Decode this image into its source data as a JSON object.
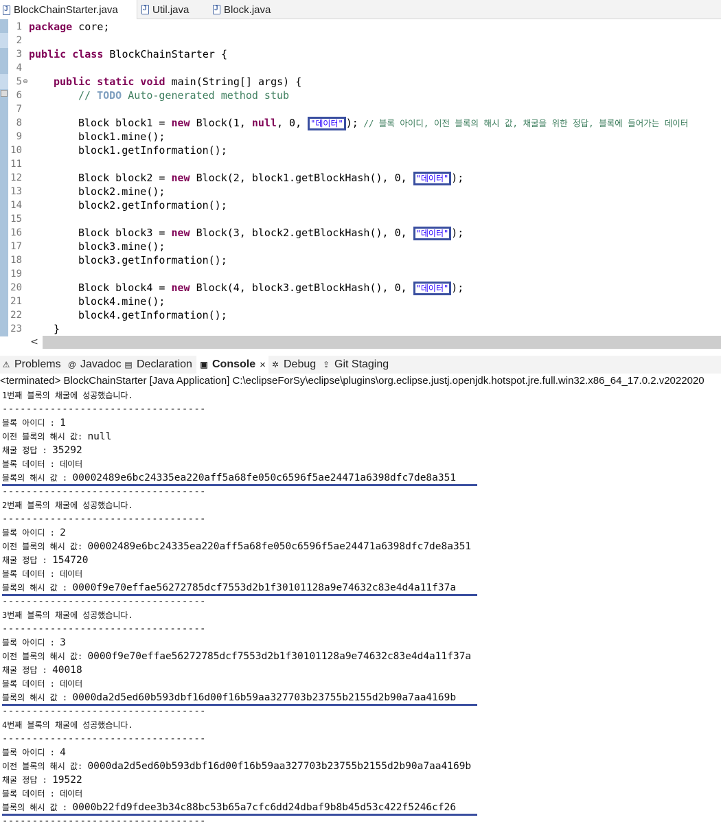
{
  "editor_tabs": [
    {
      "label": "BlockChainStarter.java",
      "active": true
    },
    {
      "label": "Util.java",
      "active": false
    },
    {
      "label": "Block.java",
      "active": false
    }
  ],
  "code": {
    "line_numbers": [
      "1",
      "2",
      "3",
      "4",
      "5",
      "6",
      "7",
      "8",
      "9",
      "10",
      "11",
      "12",
      "13",
      "14",
      "15",
      "16",
      "17",
      "18",
      "19",
      "20",
      "21",
      "22",
      "23"
    ],
    "package_kw": "package",
    "package_name": " core;",
    "class_mods": "public class",
    "class_name": " BlockChainStarter {",
    "main_mods": "public static void",
    "main_sig": " main(String[] args) {",
    "todo_comment_prefix": "// ",
    "todo_kw": "TODO",
    "todo_rest": " Auto-generated method stub",
    "new_kw": "new",
    "null_kw": "null",
    "data_string": "\"데이터\"",
    "block1_decl": "Block block1 = ",
    "block1_args_a": " Block(1, ",
    "block1_args_b": ", 0, ",
    "block1_close": ");",
    "block1_comment": " // 블록 아이디, 이전 블록의 해시 값, 채굴을 위한 정답, 블록에 들어가는 데이터",
    "block1_mine": "block1.mine();",
    "block1_info": "block1.getInformation();",
    "block2_decl": "Block block2 = ",
    "block2_args": " Block(2, block1.getBlockHash(), 0, ",
    "block2_close": ");",
    "block2_mine": "block2.mine();",
    "block2_info": "block2.getInformation();",
    "block3_decl": "Block block3 = ",
    "block3_args": " Block(3, block2.getBlockHash(), 0, ",
    "block3_close": ");",
    "block3_mine": "block3.mine();",
    "block3_info": "block3.getInformation();",
    "block4_decl": "Block block4 = ",
    "block4_args": " Block(4, block3.getBlockHash(), 0, ",
    "block4_close": ");",
    "block4_mine": "block4.mine();",
    "block4_info": "block4.getInformation();",
    "closing_brace": "}"
  },
  "view_tabs": [
    {
      "label": "Problems",
      "icon": "problems-icon"
    },
    {
      "label": "Javadoc",
      "icon": "at-icon"
    },
    {
      "label": "Declaration",
      "icon": "declaration-icon"
    },
    {
      "label": "Console",
      "icon": "console-icon",
      "active": true
    },
    {
      "label": "Debug",
      "icon": "bug-icon"
    },
    {
      "label": "Git Staging",
      "icon": "git-staging-icon"
    }
  ],
  "console": {
    "header": "<terminated> BlockChainStarter [Java Application] C:\\eclipseForSy\\eclipse\\plugins\\org.eclipse.justj.openjdk.hotspot.jre.full.win32.x86_64_17.0.2.v2022020",
    "separator": "----------------------------------",
    "blocks": [
      {
        "success": "1번째 블록의 채굴에 성공했습니다.",
        "id_label": "블록 아이디 : ",
        "id": "1",
        "prev_label": "이전 블록의 해시 값: ",
        "prev": "null",
        "answer_label": "채굴 정답 : ",
        "answer": "35292",
        "data_label": "블록 데이터 : 데이터",
        "hash_label": "블록의 해시 값 : ",
        "hash": "00002489e6bc24335ea220aff5a68fe050c6596f5ae24471a6398dfc7de8a351"
      },
      {
        "success": "2번째 블록의 채굴에 성공했습니다.",
        "id_label": "블록 아이디 : ",
        "id": "2",
        "prev_label": "이전 블록의 해시 값: ",
        "prev": "00002489e6bc24335ea220aff5a68fe050c6596f5ae24471a6398dfc7de8a351",
        "answer_label": "채굴 정답 : ",
        "answer": "154720",
        "data_label": "블록 데이터 : 데이터",
        "hash_label": "블록의 해시 값 : ",
        "hash": "0000f9e70effae56272785dcf7553d2b1f30101128a9e74632c83e4d4a11f37a"
      },
      {
        "success": "3번째 블록의 채굴에 성공했습니다.",
        "id_label": "블록 아이디 : ",
        "id": "3",
        "prev_label": "이전 블록의 해시 값: ",
        "prev": "0000f9e70effae56272785dcf7553d2b1f30101128a9e74632c83e4d4a11f37a",
        "answer_label": "채굴 정답 : ",
        "answer": "40018",
        "data_label": "블록 데이터 : 데이터",
        "hash_label": "블록의 해시 값 : ",
        "hash": "0000da2d5ed60b593dbf16d00f16b59aa327703b23755b2155d2b90a7aa4169b"
      },
      {
        "success": "4번째 블록의 채굴에 성공했습니다.",
        "id_label": "블록 아이디 : ",
        "id": "4",
        "prev_label": "이전 블록의 해시 값: ",
        "prev": "0000da2d5ed60b593dbf16d00f16b59aa327703b23755b2155d2b90a7aa4169b",
        "answer_label": "채굴 정답 : ",
        "answer": "19522",
        "data_label": "블록 데이터 : 데이터",
        "hash_label": "블록의 해시 값 : ",
        "hash": "0000b22fd9fdee3b34c88bc53b65a7cfc6dd24dbaf9b8b45d53c422f5246cf26"
      }
    ]
  },
  "colors": {
    "keyword": "#7f0055",
    "comment": "#3f7f5f",
    "string": "#2a00ff",
    "highlight_box": "#3a4fa0"
  }
}
